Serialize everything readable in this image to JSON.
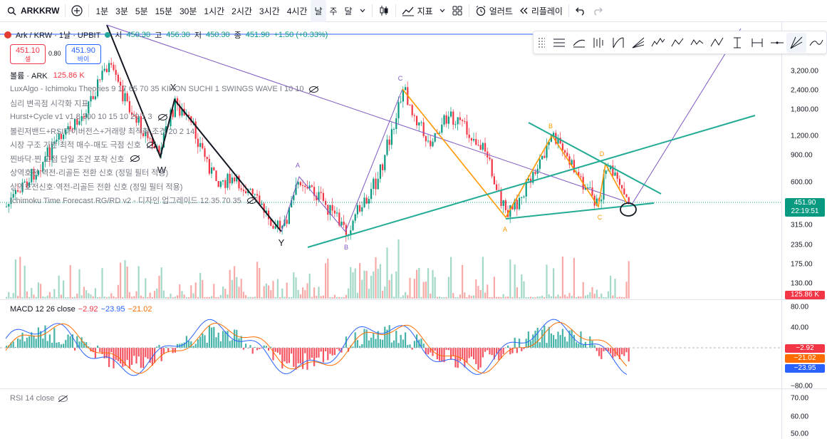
{
  "toolbar": {
    "symbol": "ARKKRW",
    "add_label": "+",
    "timeframes": [
      "1분",
      "3분",
      "5분",
      "15분",
      "30분",
      "1시간",
      "2시간",
      "3시간",
      "4시간",
      "날",
      "주",
      "달"
    ],
    "active_timeframe": "날",
    "indicators_label": "지표",
    "alert_label": "얼러트",
    "replay_label": "리플레이"
  },
  "header": {
    "title": "Ark / KRW · 1날 · UPBIT",
    "open_k": "시",
    "open_v": "450.30",
    "high_k": "고",
    "high_v": "456.30",
    "low_k": "저",
    "low_v": "450.30",
    "close_k": "종",
    "close_v": "451.90",
    "change": "+1.50 (+0.33%)"
  },
  "trade": {
    "sell_price": "451.10",
    "sell_label": "셀",
    "spread": "0.80",
    "buy_price": "451.90",
    "buy_label": "바이"
  },
  "indicators": [
    {
      "label": "볼륨 · ARK",
      "value": "125.86 K"
    },
    {
      "label": "LuxAlgo - Ichimoku Theories 9 17 65 70 35 KIHON SUCHI 1 SWINGS WAVE I 10 10"
    },
    {
      "label": "심리 변곡점 시각화 지표"
    },
    {
      "label": "Hurst+Cycle v1 v1.8 300 10 15 10 20 1 3"
    },
    {
      "label": "볼린저밴드+RSI다이버전스+거래량 최적화 조건 20 2 14"
    },
    {
      "label": "시장 구조 기반 최적 매수-매도 극점 신호"
    },
    {
      "label": "찐바닥·찐 고점 단일 조건 포착 신호"
    },
    {
      "label": "상역호전·역전-리골든 전환 신호 (정밀 필터 적용)"
    },
    {
      "label": "상역호전신호·역전-리골든 전환 신호 (정밀 필터 적용)"
    },
    {
      "label": "Ichimoku Time Forecast RG/RD v2 - 디자인 업그레이드 12 35 70 35"
    }
  ],
  "price_scale": [
    "3,200.00",
    "2,400.00",
    "1,800.00",
    "1,200.00",
    "900.00",
    "600.00",
    "315.00",
    "235.00",
    "175.00",
    "130.00"
  ],
  "price_flag": {
    "price": "451.90",
    "countdown": "22:19:51"
  },
  "volume_flag": "125.86 K",
  "macd": {
    "legend": "MACD 12 26 close",
    "macd_val": "−2.92",
    "signal_val": "−23.95",
    "hist_val": "−21.02",
    "scale": [
      "80.00",
      "40.00",
      "−40.00",
      "−80.00"
    ],
    "flags": [
      "−2.92",
      "−21.02",
      "−23.95"
    ]
  },
  "rsi": {
    "legend": "RSI 14 close",
    "scale": [
      "70.00",
      "60.00",
      "50.00"
    ]
  },
  "wave_labels": [
    "W",
    "X",
    "Y",
    "A",
    "B",
    "C",
    "A",
    "B",
    "C",
    "D"
  ],
  "colors": {
    "up": "#089981",
    "down": "#f23645",
    "accent": "#2962ff",
    "wave_purple": "#7e57c2",
    "triangle_green": "#22ab94",
    "wave_orange": "#ff9800"
  }
}
